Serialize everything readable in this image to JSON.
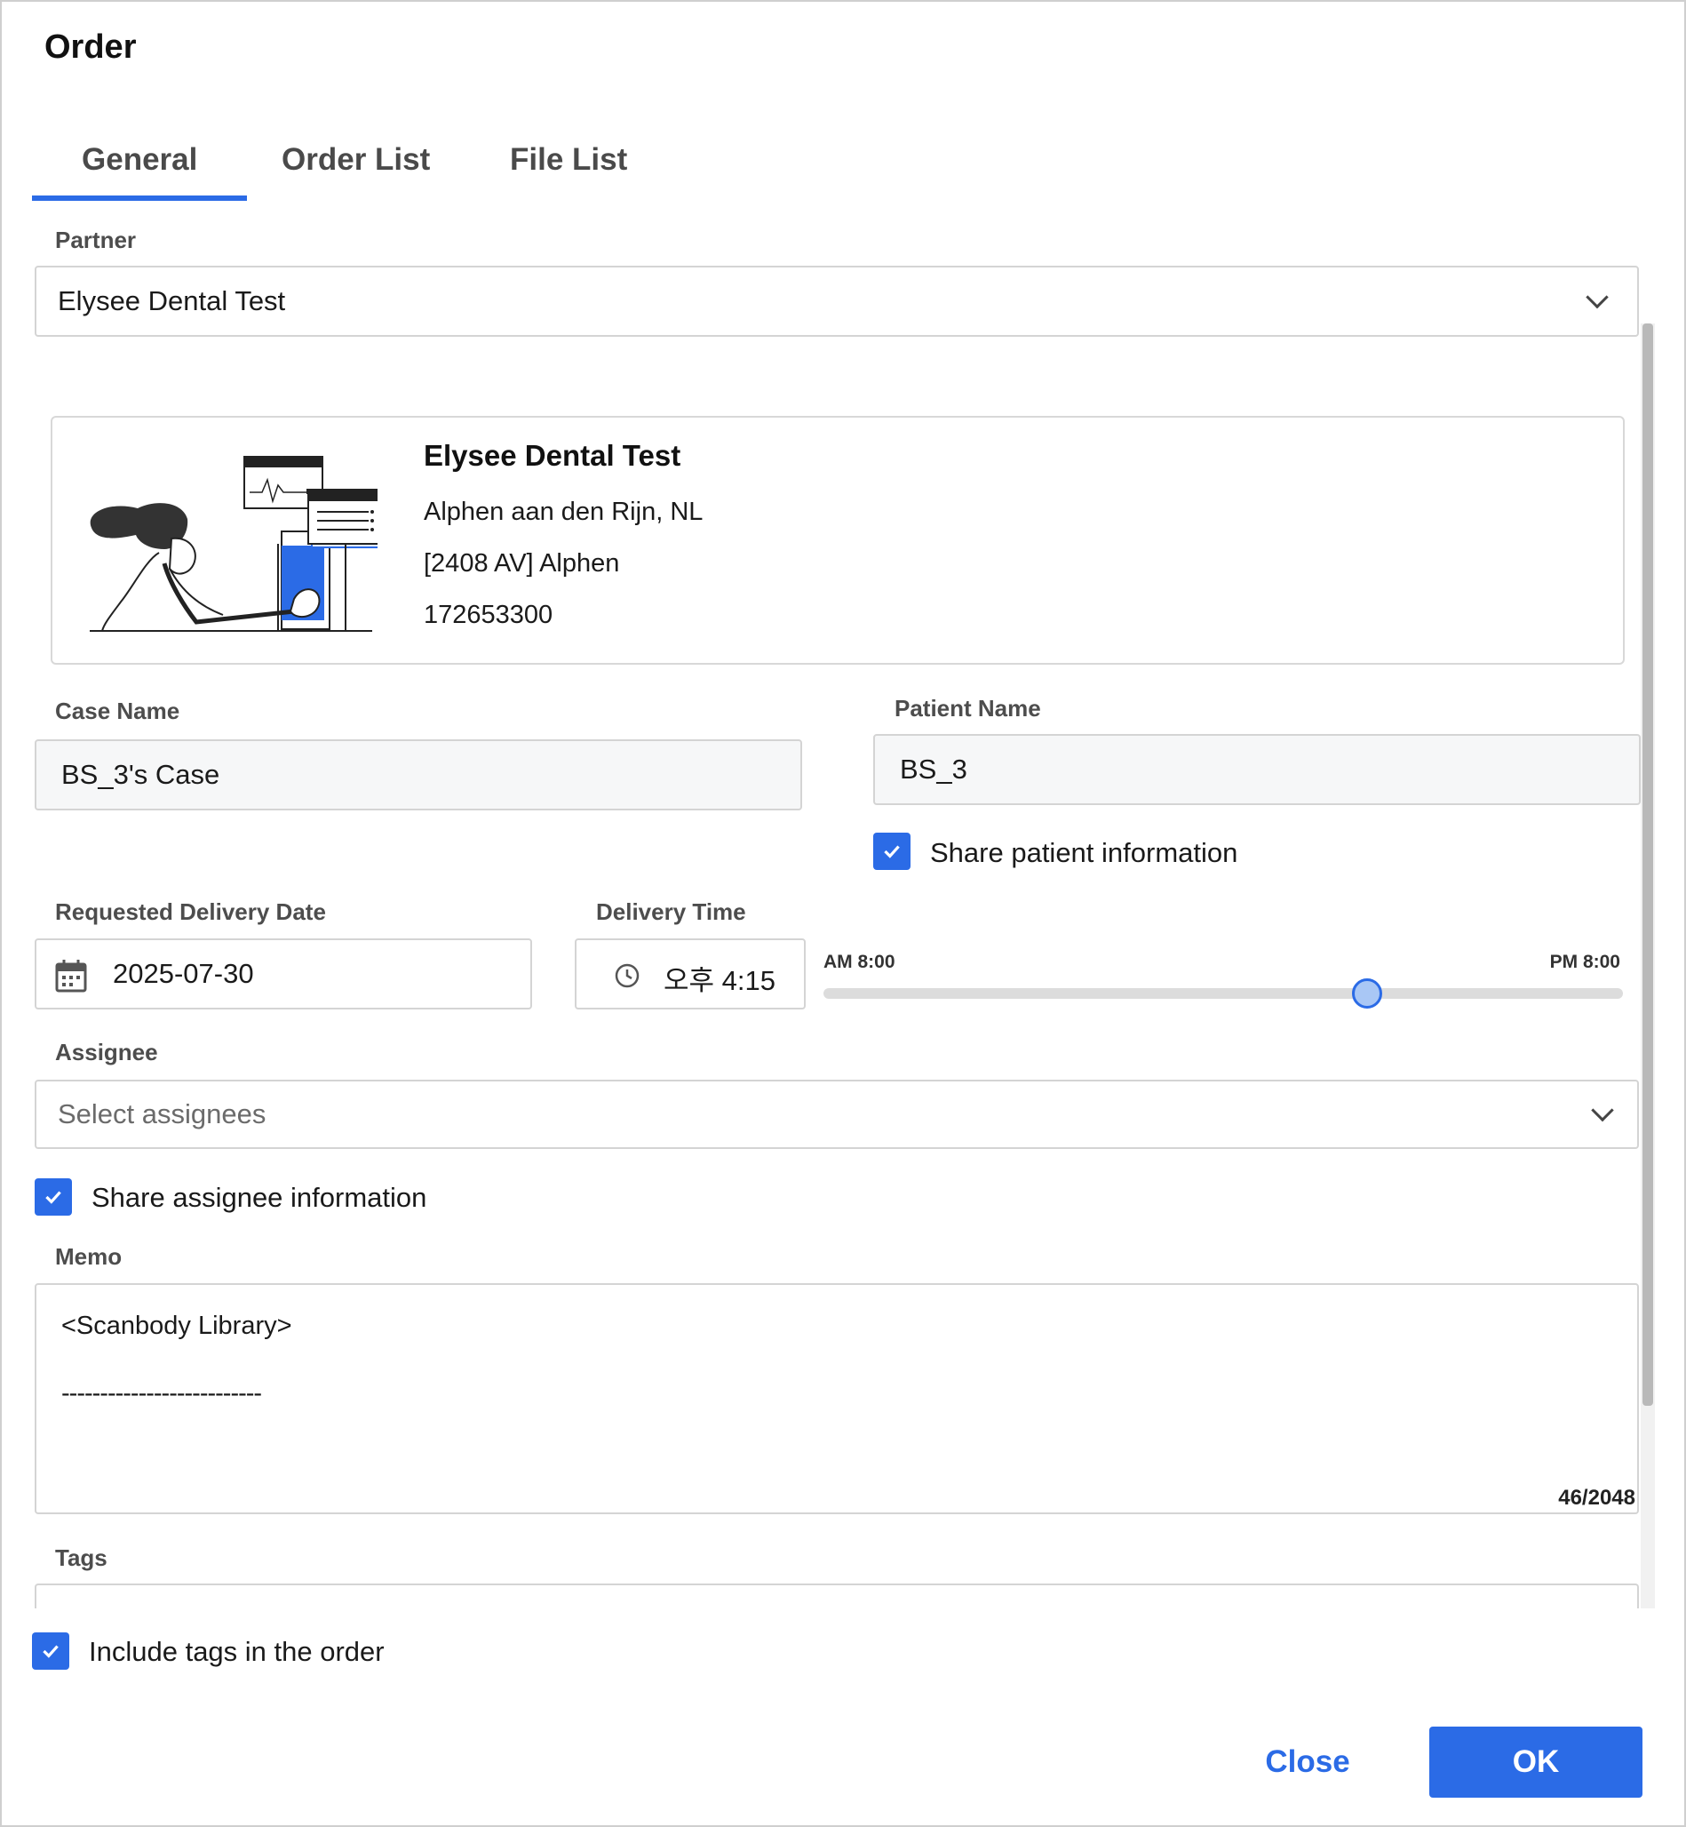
{
  "dialog": {
    "title": "Order"
  },
  "tabs": [
    {
      "label": "General",
      "active": true
    },
    {
      "label": "Order List",
      "active": false
    },
    {
      "label": "File List",
      "active": false
    }
  ],
  "partner": {
    "label": "Partner",
    "value": "Elysee Dental Test"
  },
  "partner_card": {
    "name": "Elysee Dental Test",
    "address_line1": "Alphen aan den Rijn, NL",
    "address_line2": "[2408 AV] Alphen",
    "phone": "172653300"
  },
  "case_name": {
    "label": "Case Name",
    "value": "BS_3's Case"
  },
  "patient_name": {
    "label": "Patient Name",
    "value": "BS_3"
  },
  "share_patient": {
    "label": "Share patient information",
    "checked": true
  },
  "delivery_date": {
    "label": "Requested Delivery Date",
    "value": "2025-07-30",
    "icon": "calendar-icon"
  },
  "delivery_time": {
    "label": "Delivery Time",
    "value": "오후 4:15",
    "icon": "clock-icon"
  },
  "time_slider": {
    "min_label": "AM 8:00",
    "max_label": "PM 8:00",
    "value_fraction": 0.68
  },
  "assignee": {
    "label": "Assignee",
    "placeholder": "Select assignees"
  },
  "share_assignee": {
    "label": "Share assignee information",
    "checked": true
  },
  "memo": {
    "label": "Memo",
    "line1": "<Scanbody Library>",
    "line2": "--------------------------",
    "counter": "46/2048"
  },
  "tags": {
    "label": "Tags"
  },
  "include_tags": {
    "label": "Include tags in the order",
    "checked": true
  },
  "footer": {
    "close_label": "Close",
    "ok_label": "OK"
  },
  "colors": {
    "accent": "#2b6be6",
    "border": "#d4d4d4",
    "field_bg": "#f6f7f8"
  }
}
